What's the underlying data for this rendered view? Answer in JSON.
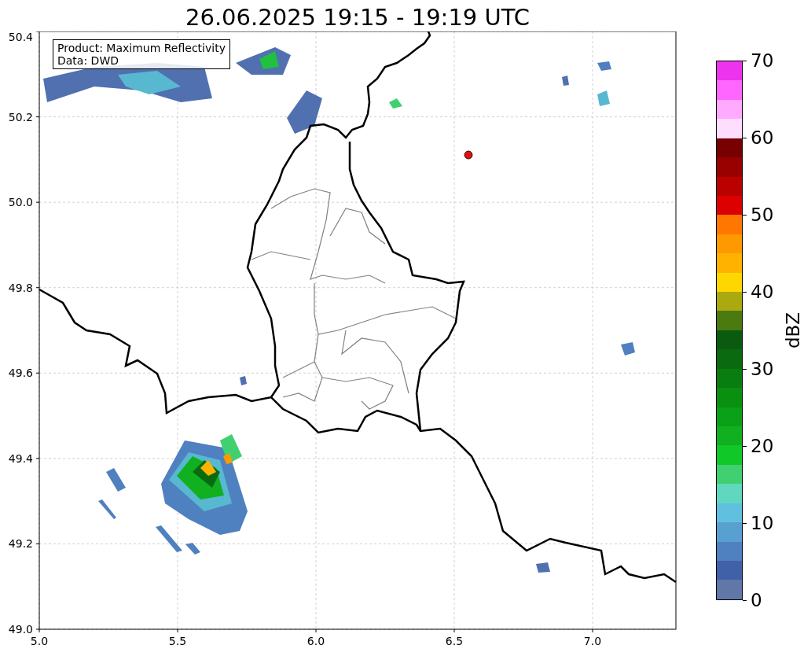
{
  "title": "26.06.2025 19:15 - 19:19 UTC",
  "info_box": {
    "lines": [
      "Product: Maximum Reflectivity",
      "Data: DWD"
    ]
  },
  "axes": {
    "xticks": [
      "5.0",
      "5.5",
      "6.0",
      "6.5",
      "7.0"
    ],
    "yticks": [
      "50.4",
      "50.2",
      "50.0",
      "49.8",
      "49.6",
      "49.4",
      "49.2",
      "49.0"
    ]
  },
  "colorbar": {
    "label": "dBZ",
    "ticks": [
      "70",
      "60",
      "50",
      "40",
      "30",
      "20",
      "10",
      "0"
    ],
    "segments": [
      {
        "color": "#ee33ee"
      },
      {
        "color": "#ff66ff"
      },
      {
        "color": "#ffaaff"
      },
      {
        "color": "#ffddff"
      },
      {
        "color": "#770000"
      },
      {
        "color": "#990000"
      },
      {
        "color": "#bb0000"
      },
      {
        "color": "#dd0000"
      },
      {
        "color": "#ff7700"
      },
      {
        "color": "#ff9900"
      },
      {
        "color": "#ffb300"
      },
      {
        "color": "#ffd700"
      },
      {
        "color": "#aaaa10"
      },
      {
        "color": "#4a7a10"
      },
      {
        "color": "#0a5a10"
      },
      {
        "color": "#0a6a10"
      },
      {
        "color": "#0a7d10"
      },
      {
        "color": "#0a9010"
      },
      {
        "color": "#0aa018"
      },
      {
        "color": "#10b020"
      },
      {
        "color": "#10c828"
      },
      {
        "color": "#40d070"
      },
      {
        "color": "#60d8c0"
      },
      {
        "color": "#60c0e0"
      },
      {
        "color": "#58a0d0"
      },
      {
        "color": "#4f80c0"
      },
      {
        "color": "#4060a8"
      },
      {
        "color": "#6078a8"
      }
    ]
  }
}
